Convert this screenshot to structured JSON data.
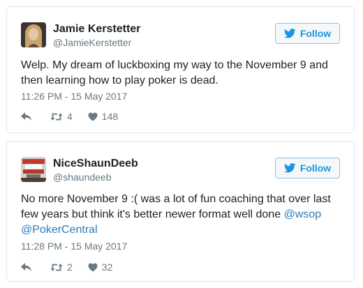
{
  "tweets": [
    {
      "name": "Jamie Kerstetter",
      "handle": "@JamieKerstetter",
      "follow_label": "Follow",
      "text": "Welp. My dream of luckboxing my way to the November 9 and then learning how to play poker is dead.",
      "timestamp": "11:26 PM - 15 May 2017",
      "retweets": "4",
      "likes": "148"
    },
    {
      "name": "NiceShaunDeeb",
      "handle": "@shaundeeb",
      "follow_label": "Follow",
      "text_before": "No more November 9 :( was a lot of fun coaching that over last few years but think it's better newer format well done ",
      "mention_1": "@wsop",
      "mention_2": "@PokerCentral",
      "timestamp": "11:28 PM - 15 May 2017",
      "retweets": "2",
      "likes": "32"
    }
  ],
  "icons": {
    "bird": "twitter-bird-icon",
    "reply": "reply-icon",
    "retweet": "retweet-icon",
    "like": "heart-icon"
  },
  "colors": {
    "accent": "#1b95e0",
    "link": "#2b7bb9",
    "muted": "#697882",
    "border": "#e1e8ed"
  }
}
